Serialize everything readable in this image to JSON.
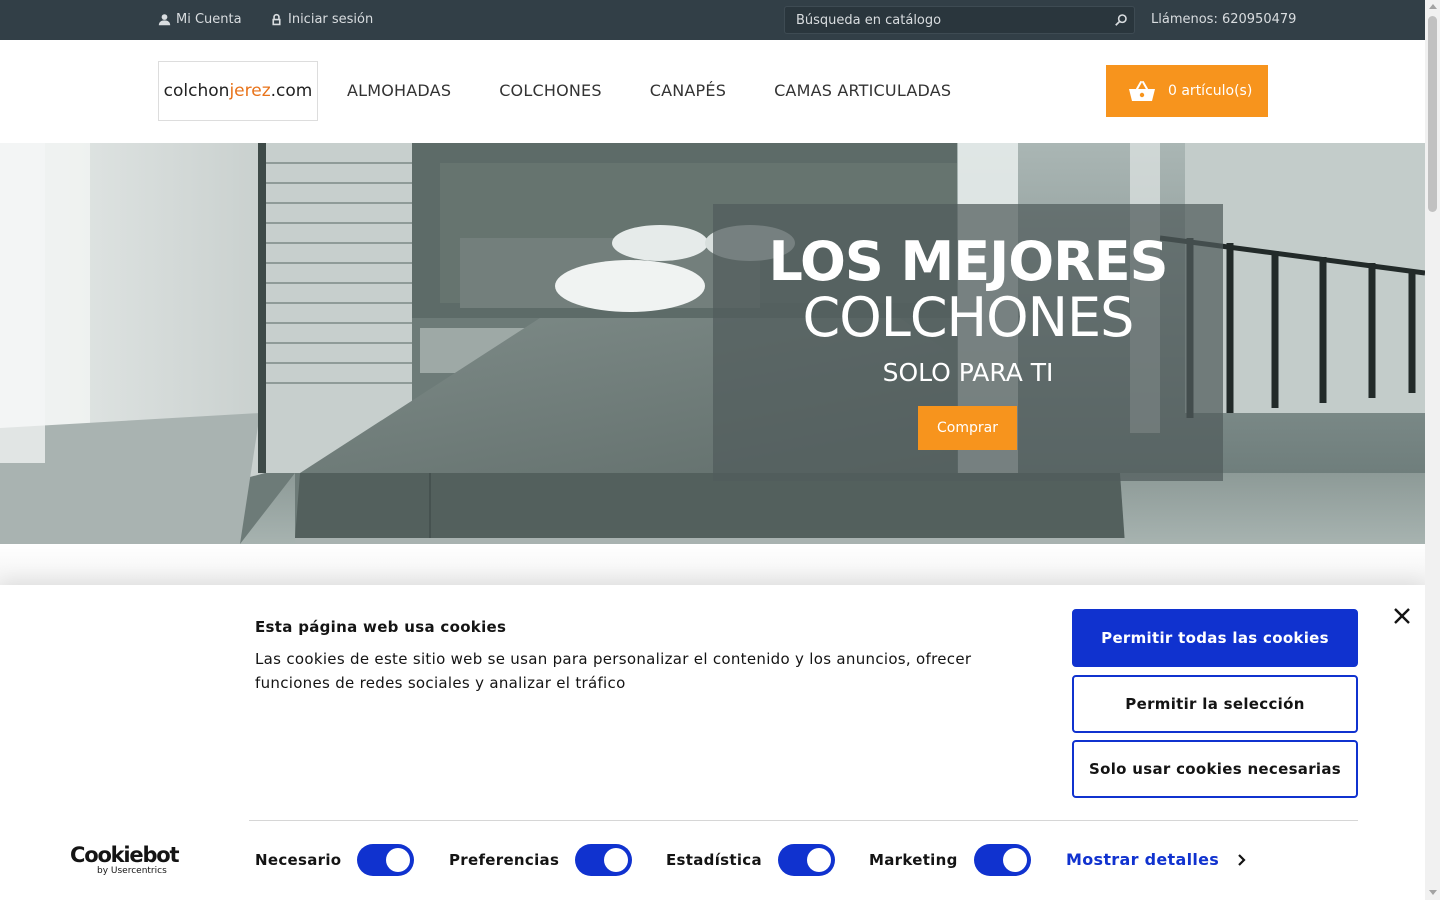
{
  "topbar": {
    "account_label": "Mi Cuenta",
    "login_label": "Iniciar sesión",
    "search_placeholder": "Búsqueda en catálogo",
    "phone": "Llámenos: 620950479"
  },
  "header": {
    "logo_part1": "colchon",
    "logo_part2": "jerez",
    "logo_part3": ".com",
    "nav": [
      "ALMOHADAS",
      "COLCHONES",
      "CANAPÉS",
      "CAMAS ARTICULADAS"
    ],
    "cart_label": "0 artículo(s)"
  },
  "hero": {
    "line1": "LOS MEJORES",
    "line2": "COLCHONES",
    "line3": "SOLO PARA TI",
    "button": "Comprar"
  },
  "cookie": {
    "title": "Esta página web usa cookies",
    "text": "Las cookies de este sitio web se usan para personalizar el contenido y los anuncios, ofrecer funciones de redes sociales y analizar el tráfico",
    "btn_all": "Permitir todas las cookies",
    "btn_selection": "Permitir la selección",
    "btn_necessary": "Solo usar cookies necesarias",
    "toggles": [
      {
        "label": "Necesario",
        "on": true
      },
      {
        "label": "Preferencias",
        "on": true
      },
      {
        "label": "Estadística",
        "on": true
      },
      {
        "label": "Marketing",
        "on": true
      }
    ],
    "details": "Mostrar detalles",
    "brand": "Cookiebot",
    "brand_by": "by Usercentrics"
  },
  "colors": {
    "topbar": "#323f47",
    "accent_orange": "#f7941d",
    "cookie_blue": "#1032cf"
  }
}
